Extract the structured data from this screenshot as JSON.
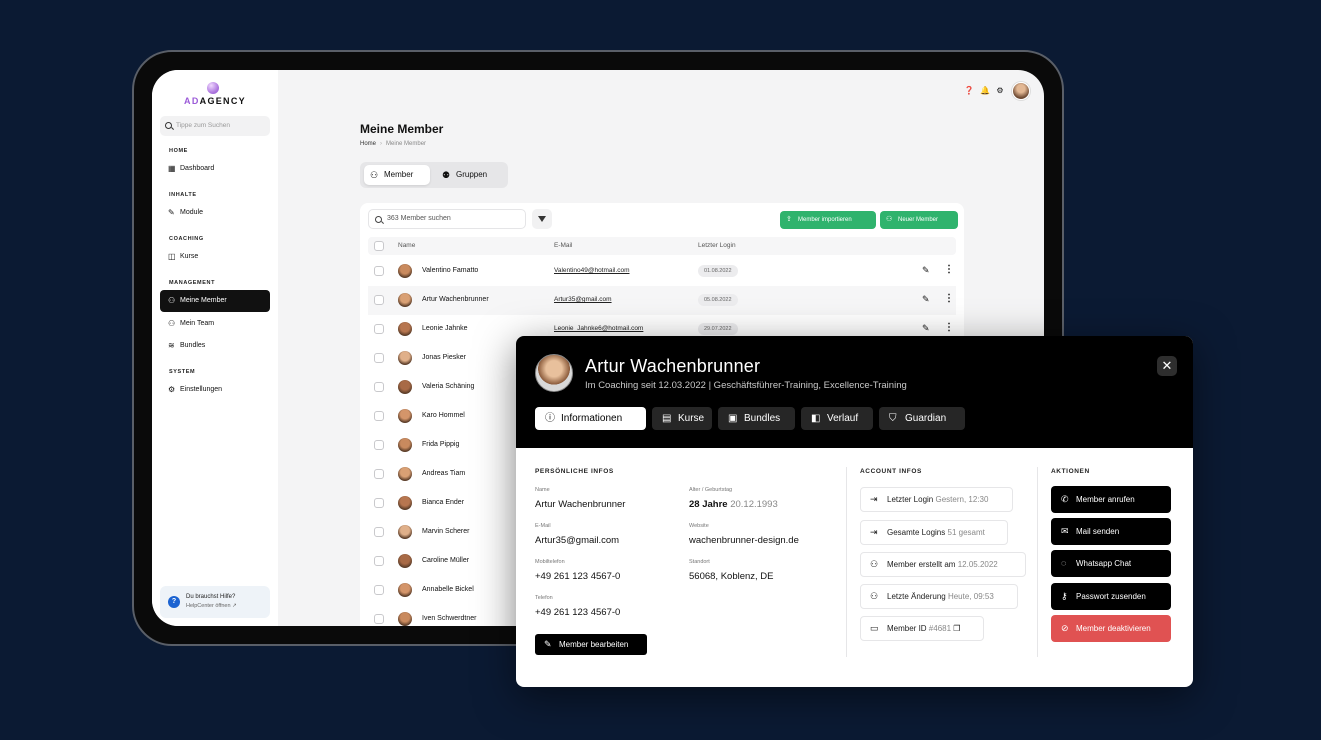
{
  "app": {
    "logo_prefix": "AD",
    "logo_suffix": "AGENCY",
    "search_placeholder": "Tippe zum Suchen"
  },
  "sidebar": {
    "sections": [
      "HOME",
      "INHALTE",
      "COACHING",
      "MANAGEMENT",
      "SYSTEM"
    ],
    "items": [
      {
        "label": "Dashboard",
        "icon": "grid-icon"
      },
      {
        "label": "Module",
        "icon": "edit-icon"
      },
      {
        "label": "Kurse",
        "icon": "chat-icon"
      },
      {
        "label": "Meine Member",
        "icon": "users-icon",
        "active": true
      },
      {
        "label": "Mein Team",
        "icon": "users-icon"
      },
      {
        "label": "Bundles",
        "icon": "stack-icon"
      },
      {
        "label": "Einstellungen",
        "icon": "gear-icon"
      }
    ],
    "help_title": "Du brauchst Hilfe?",
    "help_link": "HelpCenter öffnen ↗"
  },
  "main": {
    "title": "Meine Member",
    "breadcrumb": [
      "Home",
      "Meine Member"
    ],
    "tabs": [
      "Member",
      "Gruppen"
    ],
    "search_placeholder": "363 Member suchen",
    "import_label": "Member importieren",
    "new_label": "Neuer Member",
    "columns": [
      "Name",
      "E-Mail",
      "Letzter Login"
    ],
    "rows": [
      {
        "name": "Valentino Famatto",
        "email": "Valentino49@hotmail.com",
        "login": "01.08.2022"
      },
      {
        "name": "Artur Wachenbrunner",
        "email": "Artur35@gmail.com",
        "login": "05.08.2022"
      },
      {
        "name": "Leonie Jahnke",
        "email": "Leonie_Jahnke6@hotmail.com",
        "login": "29.07.2022"
      },
      {
        "name": "Jonas Piesker"
      },
      {
        "name": "Valeria Schäning"
      },
      {
        "name": "Karo Hommel"
      },
      {
        "name": "Frida Pippig"
      },
      {
        "name": "Andreas Tiam"
      },
      {
        "name": "Bianca Ender"
      },
      {
        "name": "Marvin Scherer"
      },
      {
        "name": "Caroline Müller"
      },
      {
        "name": "Annabelle Bickel"
      },
      {
        "name": "Iven Schwerdtner"
      }
    ]
  },
  "modal": {
    "name": "Artur Wachenbrunner",
    "subtitle": "Im Coaching seit 12.03.2022  |  Geschäftsführer-Training, Excellence-Training",
    "tabs": [
      "Informationen",
      "Kurse",
      "Bundles",
      "Verlauf",
      "Guardian"
    ],
    "personal_title": "PERSÖNLICHE INFOS",
    "fields": {
      "name_label": "Name",
      "name_value": "Artur Wachenbrunner",
      "age_label": "Alter / Geburtstag",
      "age_value": "28 Jahre",
      "birthday": "20.12.1993",
      "email_label": "E-Mail",
      "email_value": "Artur35@gmail.com",
      "website_label": "Website",
      "website_value": "wachenbrunner-design.de",
      "mobile_label": "Mobiltelefon",
      "mobile_value": "+49 261 123 4567-0",
      "location_label": "Standort",
      "location_value": "56068, Koblenz, DE",
      "phone_label": "Telefon",
      "phone_value": "+49 261 123 4567-0"
    },
    "edit_label": "Member bearbeiten",
    "account_title": "ACCOUNT INFOS",
    "account": [
      {
        "label": "Letzter Login",
        "value": "Gestern, 12:30"
      },
      {
        "label": "Gesamte Logins",
        "value": "51 gesamt"
      },
      {
        "label": "Member erstellt am",
        "value": "12.05.2022"
      },
      {
        "label": "Letzte Änderung",
        "value": "Heute, 09:53"
      },
      {
        "label": "Member ID",
        "value": "#4681"
      }
    ],
    "actions_title": "AKTIONEN",
    "actions": [
      "Member anrufen",
      "Mail senden",
      "Whatsapp Chat",
      "Passwort zusenden",
      "Member deaktivieren"
    ]
  },
  "colors": {
    "background": "#0b1a33",
    "green": "#2fb36d",
    "danger": "#e05252",
    "logo_purple": "#9b5ad8"
  }
}
